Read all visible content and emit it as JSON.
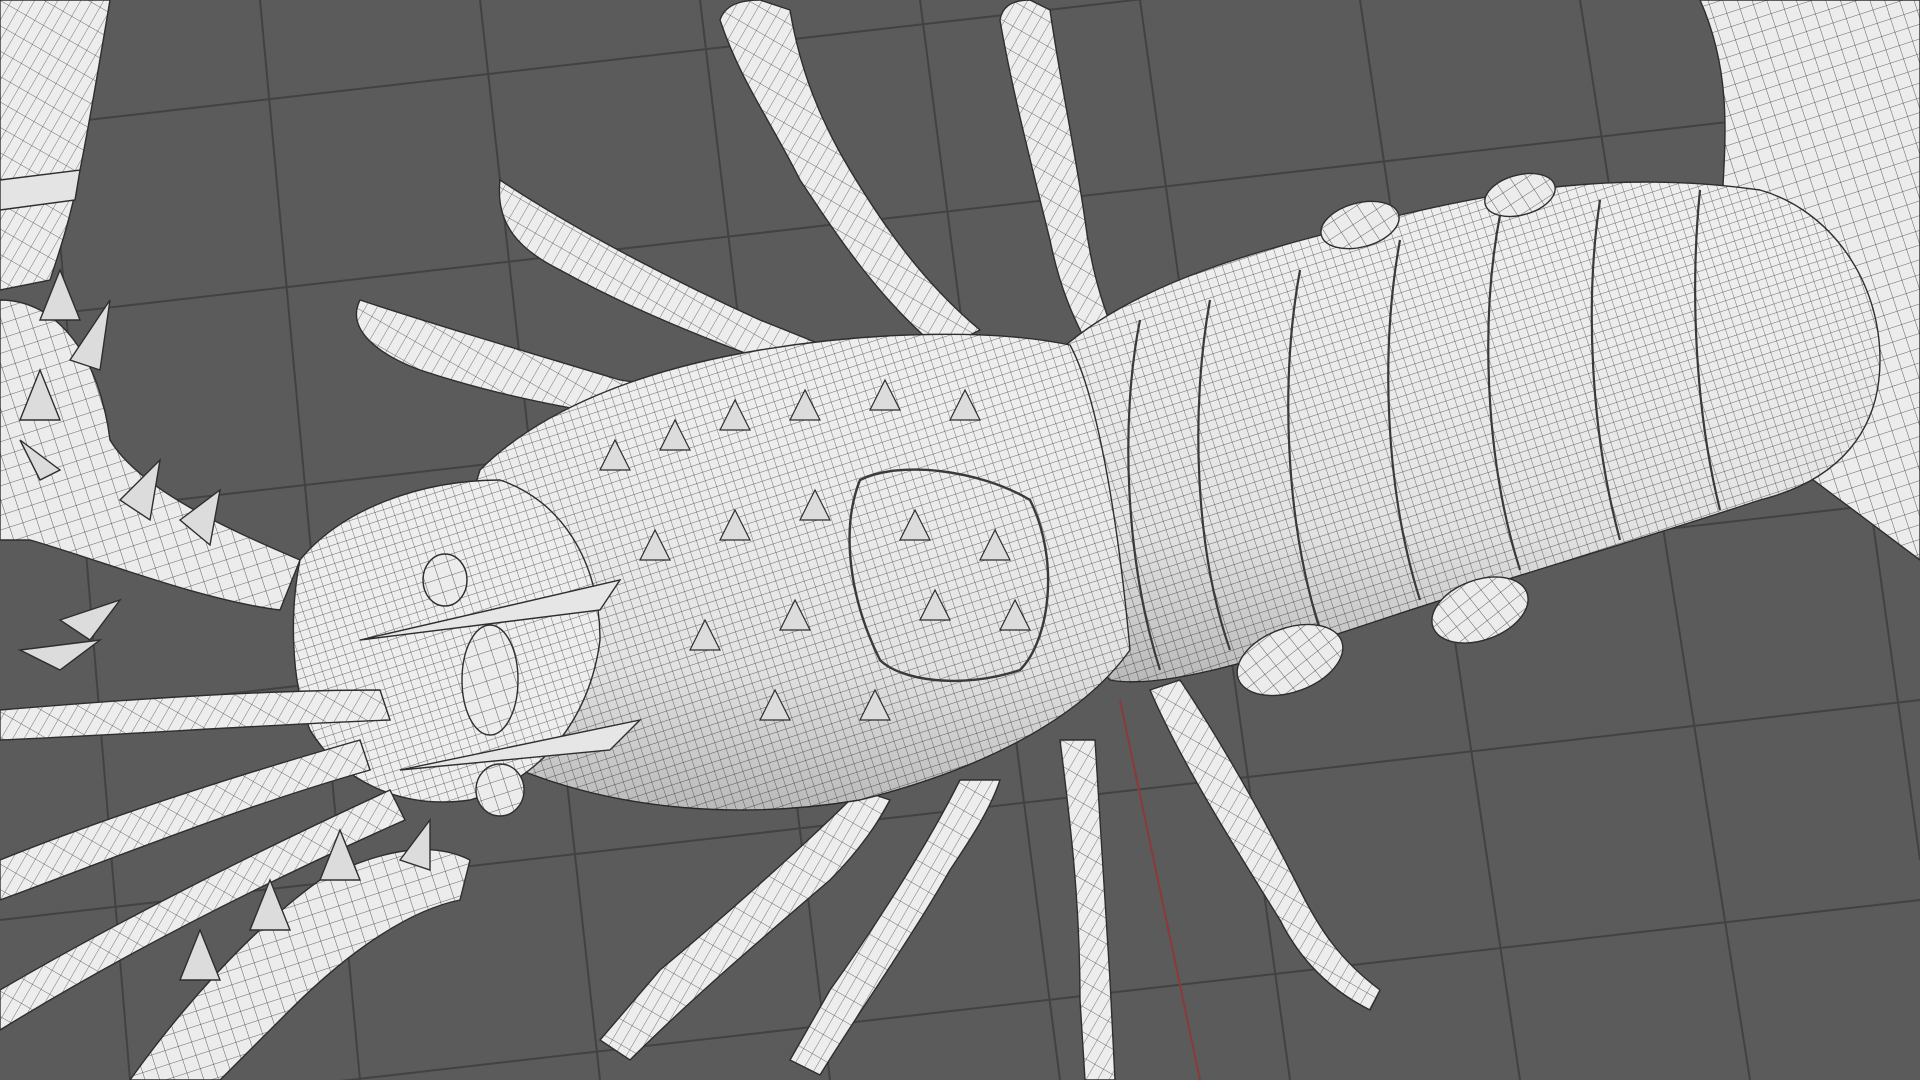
{
  "viewport": {
    "background": "#5b5b5b",
    "grid_color": "#3f3f3f",
    "axis_color": "#8a3a3a",
    "model_fill": "#ececec",
    "model_shade": "#bdbdbd",
    "wire_color": "#3a3a3a",
    "shading_mode": "wireframe-on-shaded",
    "grid": true
  },
  "model": {
    "subject": "lobster-mesh",
    "icon": "mesh-icon"
  }
}
